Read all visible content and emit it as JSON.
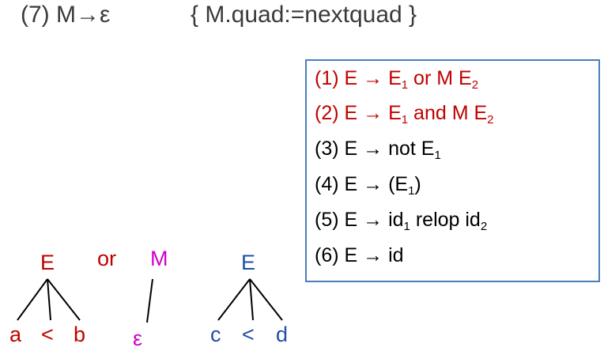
{
  "header": {
    "production": "(7) M→ε",
    "action": "{ M.quad:=nextquad }"
  },
  "rules": [
    {
      "num": "(1)",
      "lhs": "E",
      "arrow": "→",
      "rhs_parts": [
        {
          "t": "E"
        },
        {
          "sub": "1"
        },
        {
          "t": " or M E"
        },
        {
          "sub": "2"
        }
      ],
      "color": "#c00000"
    },
    {
      "num": "(2)",
      "lhs": "E",
      "arrow": "→",
      "rhs_parts": [
        {
          "t": "E"
        },
        {
          "sub": "1"
        },
        {
          "t": " and M E"
        },
        {
          "sub": "2"
        }
      ],
      "color": "#c00000"
    },
    {
      "num": "(3)",
      "lhs": "E",
      "arrow": "→",
      "rhs_parts": [
        {
          "t": "not E"
        },
        {
          "sub": "1"
        }
      ],
      "color": "#000000"
    },
    {
      "num": "(4)",
      "lhs": "E",
      "arrow": "→",
      "rhs_parts": [
        {
          "t": "(E"
        },
        {
          "sub": "1"
        },
        {
          "t": ")"
        }
      ],
      "color": "#000000"
    },
    {
      "num": "(5)",
      "lhs": "E",
      "arrow": "→",
      "rhs_parts": [
        {
          "t": "id"
        },
        {
          "sub": "1"
        },
        {
          "t": " relop id"
        },
        {
          "sub": "2"
        }
      ],
      "color": "#000000"
    },
    {
      "num": "(6)",
      "lhs": "E",
      "arrow": "→",
      "rhs_parts": [
        {
          "t": "id"
        }
      ],
      "color": "#000000"
    }
  ],
  "tree": {
    "left_root": "E",
    "left_leaves": [
      "a",
      "<",
      "b"
    ],
    "op": "or",
    "mid_root": "M",
    "mid_leaf": "ε",
    "right_root": "E",
    "right_leaves": [
      "c",
      "<",
      "d"
    ]
  },
  "colors": {
    "red": "#c00000",
    "magenta": "#cc00cc",
    "blue": "#1f4fa8",
    "box_border": "#4a7ebb"
  }
}
